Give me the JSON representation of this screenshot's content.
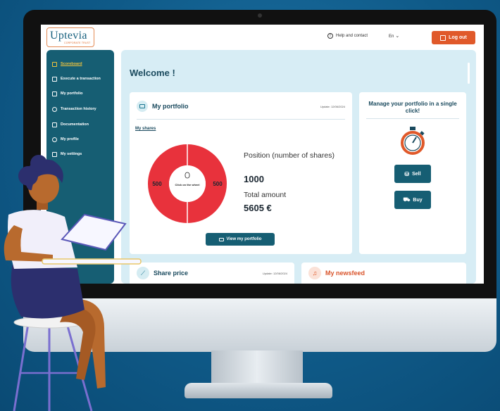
{
  "app": {
    "logo_text": "Uptevia",
    "logo_subtext": "CORPORATE TRUST"
  },
  "header": {
    "help_label": "Help and contact",
    "language": "En",
    "logout_label": "Log out"
  },
  "sidebar": {
    "items": [
      {
        "label": "Scoreboard",
        "icon": "scoreboard-icon",
        "active": true
      },
      {
        "label": "Execute a transaction",
        "icon": "transaction-icon"
      },
      {
        "label": "My portfolio",
        "icon": "portfolio-icon"
      },
      {
        "label": "Transaction history",
        "icon": "history-icon"
      },
      {
        "label": "Documentation",
        "icon": "documentation-icon"
      },
      {
        "label": "My profile",
        "icon": "profile-icon"
      },
      {
        "label": "My settings",
        "icon": "settings-icon"
      }
    ]
  },
  "main": {
    "welcome": "Welcome !",
    "portfolio": {
      "title": "My portfolio",
      "update": "Update: 12/06/2024",
      "my_shares": "My shares",
      "donut_left": "500",
      "donut_right": "500",
      "donut_center": "Click on the wheel",
      "position_label": "Position (number of shares)",
      "position_value": "1000",
      "total_label": "Total amount",
      "total_value": "5605 €",
      "view_button": "View my portfolio"
    },
    "manage": {
      "title": "Manage your portfolio in a single click!",
      "sell_label": "Sell",
      "buy_label": "Buy"
    },
    "share_price": {
      "title": "Share price",
      "update": "Update: 12/06/2024"
    },
    "newsfeed": {
      "title": "My newsfeed"
    }
  },
  "colors": {
    "accent_orange": "#e0592a",
    "primary_teal": "#165e73",
    "donut_red": "#e8323c",
    "panel_bg": "#d7edf5"
  }
}
